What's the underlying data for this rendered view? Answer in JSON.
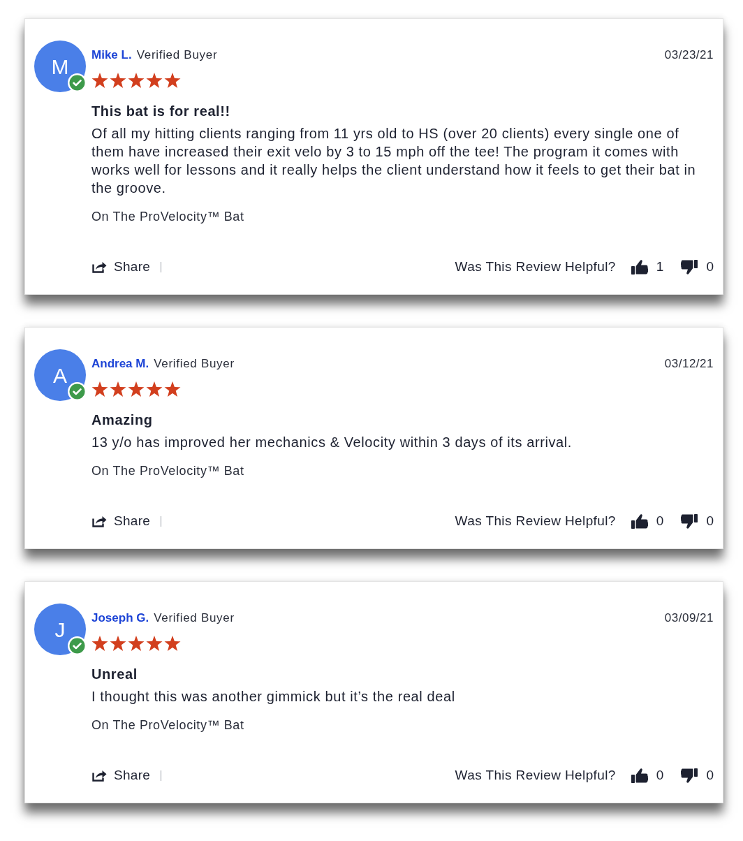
{
  "reviews": [
    {
      "avatar_letter": "M",
      "verified": true,
      "name": "Mike L.",
      "badge": "Verified Buyer",
      "date": "03/23/21",
      "stars": 5,
      "title": "This bat is for real!!",
      "body": "Of all my hitting clients ranging from 11 yrs old to HS (over 20 clients) every single one of them have increased their exit velo by 3 to 15 mph off the tee! The program it comes with works well for lessons and it really helps the client understand how it feels to get their bat in the groove.",
      "product": "On The ProVelocity™ Bat",
      "share": "Share",
      "helpful_prompt": "Was This Review Helpful?",
      "upvotes": "1",
      "downvotes": "0"
    },
    {
      "avatar_letter": "A",
      "verified": true,
      "name": "Andrea M.",
      "badge": "Verified Buyer",
      "date": "03/12/21",
      "stars": 5,
      "title": "Amazing",
      "body": "13 y/o has improved her mechanics & Velocity within 3 days of its arrival.",
      "product": "On The ProVelocity™ Bat",
      "share": "Share",
      "helpful_prompt": "Was This Review Helpful?",
      "upvotes": "0",
      "downvotes": "0"
    },
    {
      "avatar_letter": "J",
      "verified": true,
      "name": "Joseph G.",
      "badge": "Verified Buyer",
      "date": "03/09/21",
      "stars": 5,
      "title": "Unreal",
      "body": "I thought this was another gimmick but it’s the real deal",
      "product": "On The ProVelocity™ Bat",
      "share": "Share",
      "helpful_prompt": "Was This Review Helpful?",
      "upvotes": "0",
      "downvotes": "0"
    }
  ]
}
